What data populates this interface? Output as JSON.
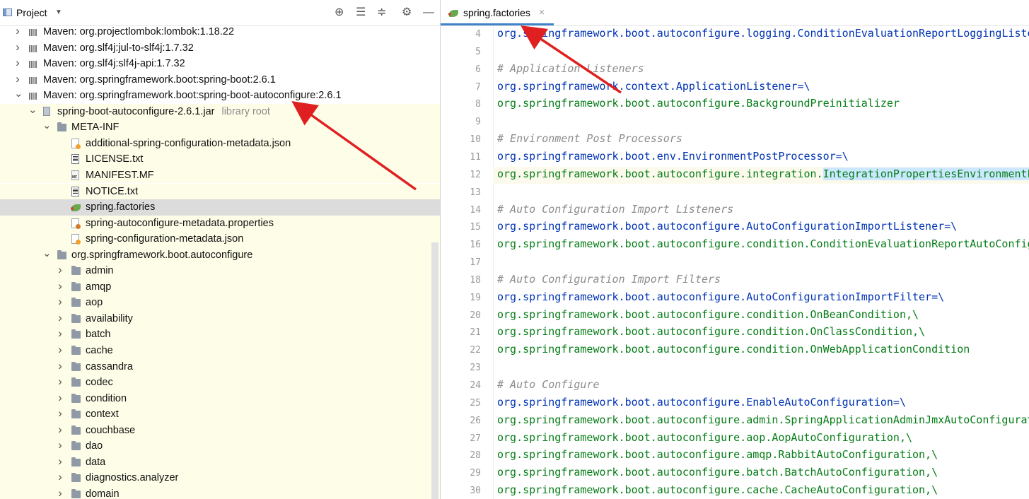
{
  "project_panel": {
    "title": "Project",
    "toolbar_icons": [
      "locate-icon",
      "expand-all-icon",
      "collapse-all-icon",
      "gear-icon",
      "minimize-icon"
    ]
  },
  "tree": [
    {
      "label": "Maven: org.projectlombok:lombok:1.18.22",
      "icon": "maven-library-icon",
      "indent": 0,
      "arrow": "right"
    },
    {
      "label": "Maven: org.slf4j:jul-to-slf4j:1.7.32",
      "icon": "maven-library-icon",
      "indent": 0,
      "arrow": "right"
    },
    {
      "label": "Maven: org.slf4j:slf4j-api:1.7.32",
      "icon": "maven-library-icon",
      "indent": 0,
      "arrow": "right"
    },
    {
      "label": "Maven: org.springframework.boot:spring-boot:2.6.1",
      "icon": "maven-library-icon",
      "indent": 0,
      "arrow": "right"
    },
    {
      "label": "Maven: org.springframework.boot:spring-boot-autoconfigure:2.6.1",
      "icon": "maven-library-icon",
      "indent": 0,
      "arrow": "down"
    },
    {
      "label": "spring-boot-autoconfigure-2.6.1.jar",
      "hint": "library root",
      "icon": "jar-icon",
      "indent": 1,
      "arrow": "down"
    },
    {
      "label": "META-INF",
      "icon": "folder-icon",
      "indent": 2,
      "arrow": "down"
    },
    {
      "label": "additional-spring-configuration-metadata.json",
      "icon": "json-file-icon",
      "indent": 3,
      "arrow": ""
    },
    {
      "label": "LICENSE.txt",
      "icon": "text-file-icon",
      "indent": 3,
      "arrow": ""
    },
    {
      "label": "MANIFEST.MF",
      "icon": "manifest-file-icon",
      "indent": 3,
      "arrow": ""
    },
    {
      "label": "NOTICE.txt",
      "icon": "text-file-icon",
      "indent": 3,
      "arrow": ""
    },
    {
      "label": "spring.factories",
      "icon": "spring-leaf-icon",
      "indent": 3,
      "arrow": "",
      "selected": true
    },
    {
      "label": "spring-autoconfigure-metadata.properties",
      "icon": "properties-file-icon",
      "indent": 3,
      "arrow": ""
    },
    {
      "label": "spring-configuration-metadata.json",
      "icon": "json-file-icon",
      "indent": 3,
      "arrow": ""
    },
    {
      "label": "org.springframework.boot.autoconfigure",
      "icon": "folder-icon",
      "indent": 2,
      "arrow": "down"
    },
    {
      "label": "admin",
      "icon": "folder-icon",
      "indent": 3,
      "arrow": "right"
    },
    {
      "label": "amqp",
      "icon": "folder-icon",
      "indent": 3,
      "arrow": "right"
    },
    {
      "label": "aop",
      "icon": "folder-icon",
      "indent": 3,
      "arrow": "right"
    },
    {
      "label": "availability",
      "icon": "folder-icon",
      "indent": 3,
      "arrow": "right"
    },
    {
      "label": "batch",
      "icon": "folder-icon",
      "indent": 3,
      "arrow": "right"
    },
    {
      "label": "cache",
      "icon": "folder-icon",
      "indent": 3,
      "arrow": "right"
    },
    {
      "label": "cassandra",
      "icon": "folder-icon",
      "indent": 3,
      "arrow": "right"
    },
    {
      "label": "codec",
      "icon": "folder-icon",
      "indent": 3,
      "arrow": "right"
    },
    {
      "label": "condition",
      "icon": "folder-icon",
      "indent": 3,
      "arrow": "right"
    },
    {
      "label": "context",
      "icon": "folder-icon",
      "indent": 3,
      "arrow": "right"
    },
    {
      "label": "couchbase",
      "icon": "folder-icon",
      "indent": 3,
      "arrow": "right"
    },
    {
      "label": "dao",
      "icon": "folder-icon",
      "indent": 3,
      "arrow": "right"
    },
    {
      "label": "data",
      "icon": "folder-icon",
      "indent": 3,
      "arrow": "right"
    },
    {
      "label": "diagnostics.analyzer",
      "icon": "folder-icon",
      "indent": 3,
      "arrow": "right"
    },
    {
      "label": "domain",
      "icon": "folder-icon",
      "indent": 3,
      "arrow": "right"
    }
  ],
  "editor": {
    "tab_label": "spring.factories",
    "tab_close": "×",
    "lines": [
      {
        "n": "4",
        "type": "code",
        "key": "org.springframework.boot.autoconfigure.logging.ConditionEvaluationReportLoggingListe",
        "rest": ""
      },
      {
        "n": "5",
        "type": "blank"
      },
      {
        "n": "6",
        "type": "comment",
        "text": "# Application Listeners"
      },
      {
        "n": "7",
        "type": "code",
        "key": "org.springframework.context.ApplicationListener",
        "rest": "=\\"
      },
      {
        "n": "8",
        "type": "plain",
        "text": "org.springframework.boot.autoconfigure.BackgroundPreinitializer"
      },
      {
        "n": "9",
        "type": "blank"
      },
      {
        "n": "10",
        "type": "comment",
        "text": "# Environment Post Processors"
      },
      {
        "n": "11",
        "type": "code",
        "key": "org.springframework.boot.env.EnvironmentPostProcessor",
        "rest": "=\\"
      },
      {
        "n": "12",
        "type": "hl",
        "text": "org.springframework.boot.autoconfigure.integration.",
        "hl": "IntegrationPropertiesEnvironmentP"
      },
      {
        "n": "13",
        "type": "blank"
      },
      {
        "n": "14",
        "type": "comment",
        "text": "# Auto Configuration Import Listeners"
      },
      {
        "n": "15",
        "type": "code",
        "key": "org.springframework.boot.autoconfigure.AutoConfigurationImportListener",
        "rest": "=\\"
      },
      {
        "n": "16",
        "type": "plain",
        "text": "org.springframework.boot.autoconfigure.condition.ConditionEvaluationReportAutoConfig"
      },
      {
        "n": "17",
        "type": "blank"
      },
      {
        "n": "18",
        "type": "comment",
        "text": "# Auto Configuration Import Filters"
      },
      {
        "n": "19",
        "type": "code",
        "key": "org.springframework.boot.autoconfigure.AutoConfigurationImportFilter",
        "rest": "=\\"
      },
      {
        "n": "20",
        "type": "plain",
        "text": "org.springframework.boot.autoconfigure.condition.OnBeanCondition,\\"
      },
      {
        "n": "21",
        "type": "plain",
        "text": "org.springframework.boot.autoconfigure.condition.OnClassCondition,\\"
      },
      {
        "n": "22",
        "type": "plain",
        "text": "org.springframework.boot.autoconfigure.condition.OnWebApplicationCondition"
      },
      {
        "n": "23",
        "type": "blank"
      },
      {
        "n": "24",
        "type": "comment",
        "text": "# Auto Configure"
      },
      {
        "n": "25",
        "type": "code",
        "key": "org.springframework.boot.autoconfigure.EnableAutoConfiguration",
        "rest": "=\\"
      },
      {
        "n": "26",
        "type": "plain",
        "text": "org.springframework.boot.autoconfigure.admin.SpringApplicationAdminJmxAutoConfigurat"
      },
      {
        "n": "27",
        "type": "plain",
        "text": "org.springframework.boot.autoconfigure.aop.AopAutoConfiguration,\\"
      },
      {
        "n": "28",
        "type": "plain",
        "text": "org.springframework.boot.autoconfigure.amqp.RabbitAutoConfiguration,\\"
      },
      {
        "n": "29",
        "type": "plain",
        "text": "org.springframework.boot.autoconfigure.batch.BatchAutoConfiguration,\\"
      },
      {
        "n": "30",
        "type": "plain",
        "text": "org.springframework.boot.autoconfigure.cache.CacheAutoConfiguration,\\"
      }
    ]
  },
  "colors": {
    "annotation_arrow": "#e02020",
    "key": "#0033b3",
    "value": "#067d17",
    "comment": "#8c8c8c",
    "selection": "#cce8ff",
    "library_bg": "#fdfde8"
  }
}
